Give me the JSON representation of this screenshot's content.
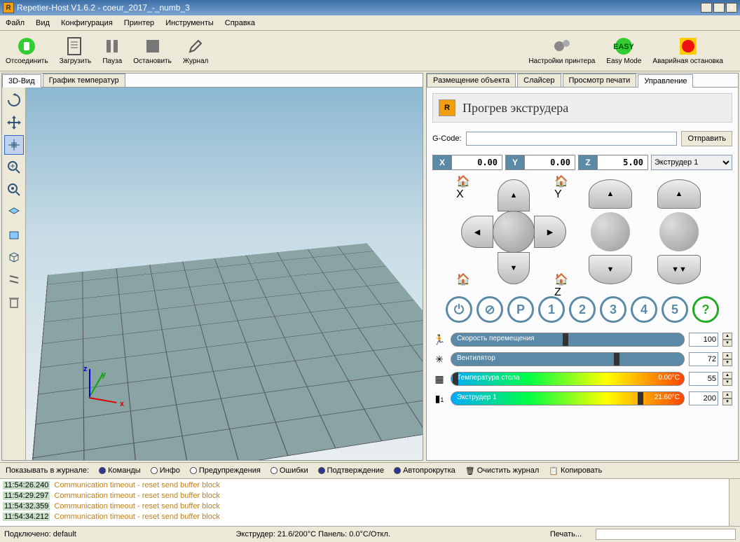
{
  "window": {
    "title": "Repetier-Host V1.6.2 - coeur_2017_-_numb_3"
  },
  "menu": {
    "file": "Файл",
    "view": "Вид",
    "config": "Конфигурация",
    "printer": "Принтер",
    "tools": "Инструменты",
    "help": "Справка"
  },
  "toolbar": {
    "disconnect": "Отсоединить",
    "load": "Загрузить",
    "pause": "Пауза",
    "stop": "Остановить",
    "log": "Журнал",
    "printer_settings": "Настройки принтера",
    "easy": "Easy Mode",
    "estop": "Аварийная остановка"
  },
  "left_tabs": {
    "view3d": "3D-Вид",
    "tempgraph": "График температур"
  },
  "axes_labels": {
    "x": "x",
    "y": "y",
    "z": "z"
  },
  "right_tabs": {
    "placement": "Размещение объекта",
    "slicer": "Слайсер",
    "preview": "Просмотр печати",
    "control": "Управление"
  },
  "panel": {
    "title": "Прогрев экструдера"
  },
  "gcode": {
    "label": "G-Code:",
    "value": "",
    "send": "Отправить"
  },
  "coords": {
    "x_label": "X",
    "x_val": "0.00",
    "y_label": "Y",
    "y_val": "0.00",
    "z_label": "Z",
    "z_val": "5.00",
    "extruder_sel": "Экструдер 1"
  },
  "round": {
    "power": "⏻",
    "stop": "⊘",
    "park": "P",
    "b1": "1",
    "b2": "2",
    "b3": "3",
    "b4": "4",
    "b5": "5",
    "help": "?"
  },
  "sliders": {
    "speed_label": "Скорость перемещения",
    "speed_val": "100",
    "fan_label": "Вентилятор",
    "fan_val": "72",
    "bed_label": "Температура стола",
    "bed_temp": "0.00°C",
    "bed_val": "55",
    "ext_label": "Экструдер 1",
    "ext_temp": "21.60°C",
    "ext_val": "200",
    "ext_num": "1"
  },
  "logfilter": {
    "show": "Показывать в журнале:",
    "cmds": "Команды",
    "info": "Инфо",
    "warn": "Предупреждения",
    "err": "Ошибки",
    "ack": "Подтверждение",
    "auto": "Автопрокрутка",
    "clear": "Очистить журнал",
    "copy": "Копировать"
  },
  "log": [
    {
      "ts": "11:54:26.240",
      "msg": "Communication timeout - reset send buffer block"
    },
    {
      "ts": "11:54:29.297",
      "msg": "Communication timeout - reset send buffer block"
    },
    {
      "ts": "11:54:32.359",
      "msg": "Communication timeout - reset send buffer block"
    },
    {
      "ts": "11:54:34.212",
      "msg": "Communication timeout - reset send buffer block"
    }
  ],
  "status": {
    "conn": "Подключено: default",
    "temps": "Экструдер: 21.6/200°C Панель: 0.0°C/Откл.",
    "print": "Печать..."
  }
}
